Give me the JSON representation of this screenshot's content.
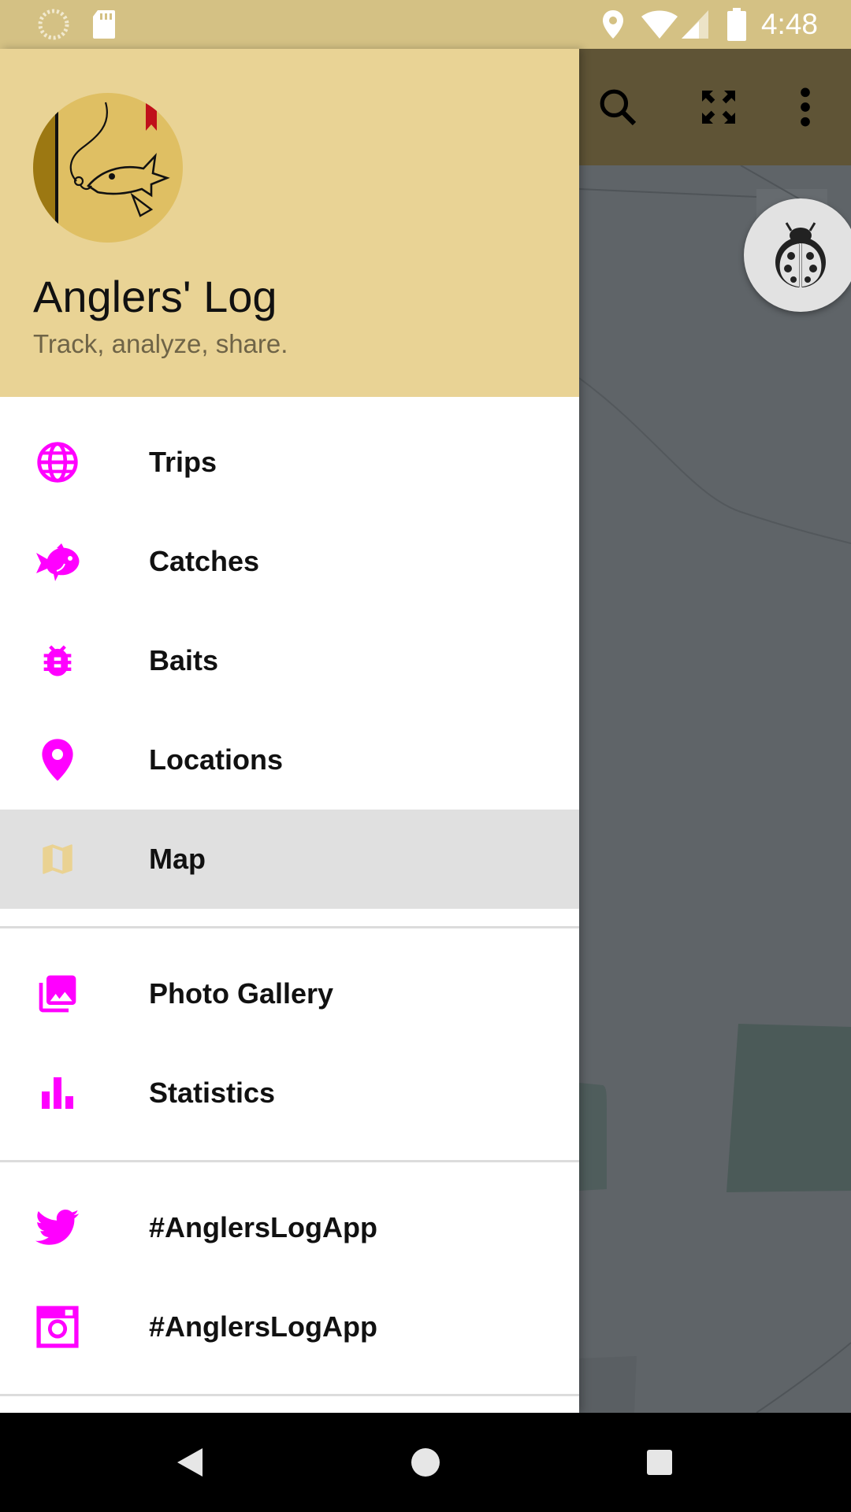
{
  "status_bar": {
    "time": "4:48",
    "icons": [
      "loading-icon",
      "sd-card-icon",
      "location-icon",
      "wifi-icon",
      "signal-icon",
      "battery-icon"
    ]
  },
  "toolbar": {
    "icons": [
      "search-icon",
      "fullscreen-icon",
      "more-vert-icon"
    ]
  },
  "drawer": {
    "header": {
      "title": "Anglers' Log",
      "subtitle": "Track, analyze, share."
    },
    "items": [
      {
        "label": "Trips",
        "icon": "globe-icon",
        "active": false
      },
      {
        "label": "Catches",
        "icon": "fish-icon",
        "active": false
      },
      {
        "label": "Baits",
        "icon": "bug-icon",
        "active": false
      },
      {
        "label": "Locations",
        "icon": "location-pin-icon",
        "active": false
      },
      {
        "label": "Map",
        "icon": "map-icon",
        "active": true
      },
      {
        "label": "Photo Gallery",
        "icon": "photo-gallery-icon",
        "active": false
      },
      {
        "label": "Statistics",
        "icon": "bar-chart-icon",
        "active": false
      },
      {
        "label": "#AnglersLogApp",
        "icon": "twitter-icon",
        "active": false
      },
      {
        "label": "#AnglersLogApp",
        "icon": "instagram-icon",
        "active": false
      }
    ]
  },
  "colors": {
    "accent": "#ff00ff",
    "header_bg": "#e9d395",
    "status_bar_bg": "#d4c184",
    "active_item_bg": "#e0e0e0",
    "active_icon": "#ead292"
  },
  "nav_bar": {
    "icons": [
      "back-icon",
      "home-icon",
      "recents-icon"
    ]
  }
}
